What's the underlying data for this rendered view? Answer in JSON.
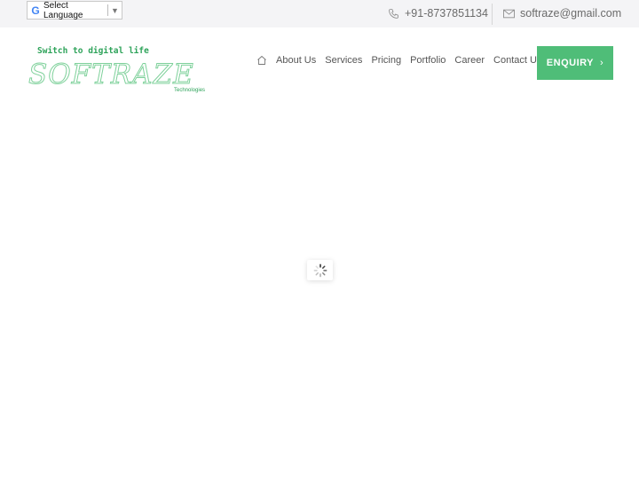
{
  "topbar": {
    "language_label": "Select Language",
    "language_arrow": "▼",
    "phone": "+91-8737851134",
    "email": "softraze@gmail.com"
  },
  "logo": {
    "tagline": "Switch to digital life",
    "name": "SOFTRAZE",
    "subtitle": "Technologies"
  },
  "nav": {
    "items": [
      "About Us",
      "Services",
      "Pricing",
      "Portfolio",
      "Career",
      "Contact Us"
    ]
  },
  "cta": {
    "label": "ENQUIRY"
  },
  "colors": {
    "accent": "#4fbd78",
    "logo": "#7fd19b"
  },
  "icons": {
    "home": "home-icon",
    "phone": "phone-icon",
    "mail": "mail-icon",
    "spinner": "spinner-icon"
  }
}
